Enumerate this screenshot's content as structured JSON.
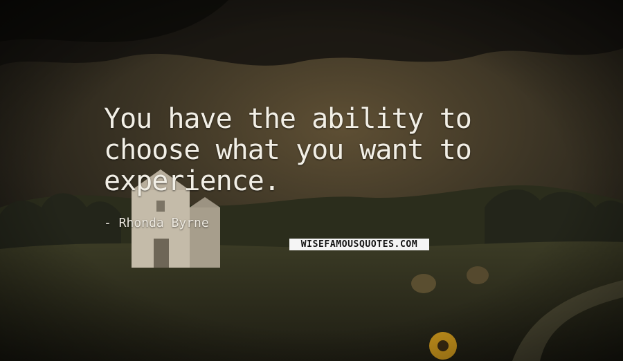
{
  "quote": {
    "text": "You have the ability to\nchoose what you want to\nexperience.",
    "author": "- Rhonda Byrne"
  },
  "watermark": {
    "text": "WISEFAMOUSQUOTES.COM"
  },
  "scene": {
    "description_icon": "barn-landscape-image",
    "colors": {
      "sky_dark": "#1d1b17",
      "sky_glow": "#6b5a3a",
      "hills": "#2f3220",
      "field": "#3a3a24",
      "barn": "#cfc6b4",
      "text": "#f2efe6"
    }
  }
}
